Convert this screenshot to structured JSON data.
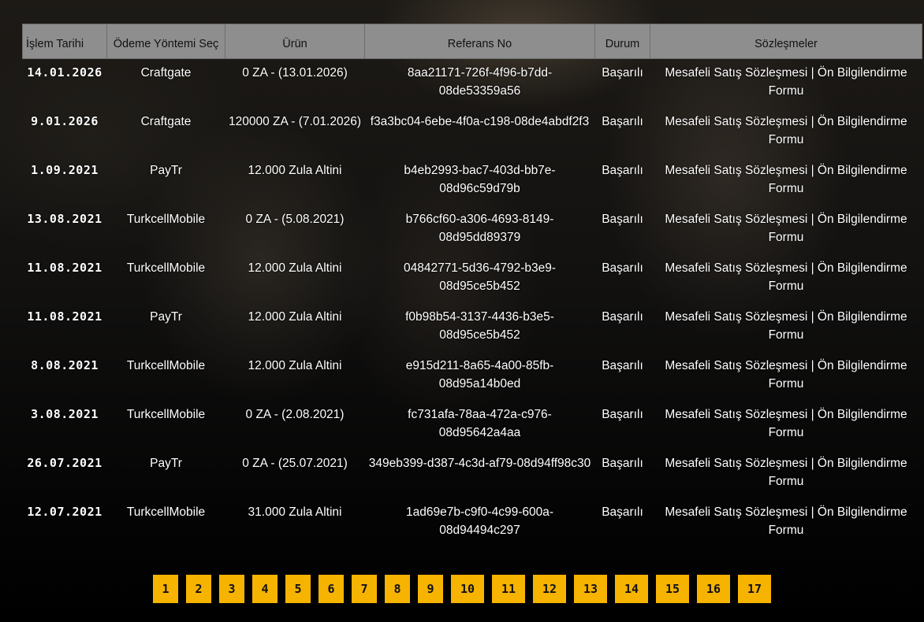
{
  "table": {
    "headers": [
      "İşlem Tarihi",
      "Ödeme Yöntemi Seç",
      "Ürün",
      "Referans No",
      "Durum",
      "Sözleşmeler"
    ],
    "rows": [
      {
        "date": "14.01.2026",
        "method": "Craftgate",
        "product": "0 ZA - (13.01.2026)",
        "ref": "8aa21171-726f-4f96-b7dd-08de53359a56",
        "status": "Başarılı",
        "contract": "Mesafeli Satış Sözleşmesi | Ön Bilgilendirme Formu"
      },
      {
        "date": "9.01.2026",
        "method": "Craftgate",
        "product": "120000 ZA - (7.01.2026)",
        "ref": "f3a3bc04-6ebe-4f0a-c198-08de4abdf2f3",
        "status": "Başarılı",
        "contract": "Mesafeli Satış Sözleşmesi | Ön Bilgilendirme Formu"
      },
      {
        "date": "1.09.2021",
        "method": "PayTr",
        "product": "12.000 Zula Altini",
        "ref": "b4eb2993-bac7-403d-bb7e-08d96c59d79b",
        "status": "Başarılı",
        "contract": "Mesafeli Satış Sözleşmesi | Ön Bilgilendirme Formu"
      },
      {
        "date": "13.08.2021",
        "method": "TurkcellMobile",
        "product": "0 ZA - (5.08.2021)",
        "ref": "b766cf60-a306-4693-8149-08d95dd89379",
        "status": "Başarılı",
        "contract": "Mesafeli Satış Sözleşmesi | Ön Bilgilendirme Formu"
      },
      {
        "date": "11.08.2021",
        "method": "TurkcellMobile",
        "product": "12.000 Zula Altini",
        "ref": "04842771-5d36-4792-b3e9-08d95ce5b452",
        "status": "Başarılı",
        "contract": "Mesafeli Satış Sözleşmesi | Ön Bilgilendirme Formu"
      },
      {
        "date": "11.08.2021",
        "method": "PayTr",
        "product": "12.000 Zula Altini",
        "ref": "f0b98b54-3137-4436-b3e5-08d95ce5b452",
        "status": "Başarılı",
        "contract": "Mesafeli Satış Sözleşmesi | Ön Bilgilendirme Formu"
      },
      {
        "date": "8.08.2021",
        "method": "TurkcellMobile",
        "product": "12.000 Zula Altini",
        "ref": "e915d211-8a65-4a00-85fb-08d95a14b0ed",
        "status": "Başarılı",
        "contract": "Mesafeli Satış Sözleşmesi | Ön Bilgilendirme Formu"
      },
      {
        "date": "3.08.2021",
        "method": "TurkcellMobile",
        "product": "0 ZA - (2.08.2021)",
        "ref": "fc731afa-78aa-472a-c976-08d95642a4aa",
        "status": "Başarılı",
        "contract": "Mesafeli Satış Sözleşmesi | Ön Bilgilendirme Formu"
      },
      {
        "date": "26.07.2021",
        "method": "PayTr",
        "product": "0 ZA - (25.07.2021)",
        "ref": "349eb399-d387-4c3d-af79-08d94ff98c30",
        "status": "Başarılı",
        "contract": "Mesafeli Satış Sözleşmesi | Ön Bilgilendirme Formu"
      },
      {
        "date": "12.07.2021",
        "method": "TurkcellMobile",
        "product": "31.000 Zula Altini",
        "ref": "1ad69e7b-c9f0-4c99-600a-08d94494c297",
        "status": "Başarılı",
        "contract": "Mesafeli Satış Sözleşmesi | Ön Bilgilendirme Formu"
      }
    ]
  },
  "pagination": {
    "pages": [
      "1",
      "2",
      "3",
      "4",
      "5",
      "6",
      "7",
      "8",
      "9",
      "10",
      "11",
      "12",
      "13",
      "14",
      "15",
      "16",
      "17"
    ]
  },
  "colors": {
    "header_bg": "#8e8e8e",
    "page_button": "#f6b300"
  }
}
